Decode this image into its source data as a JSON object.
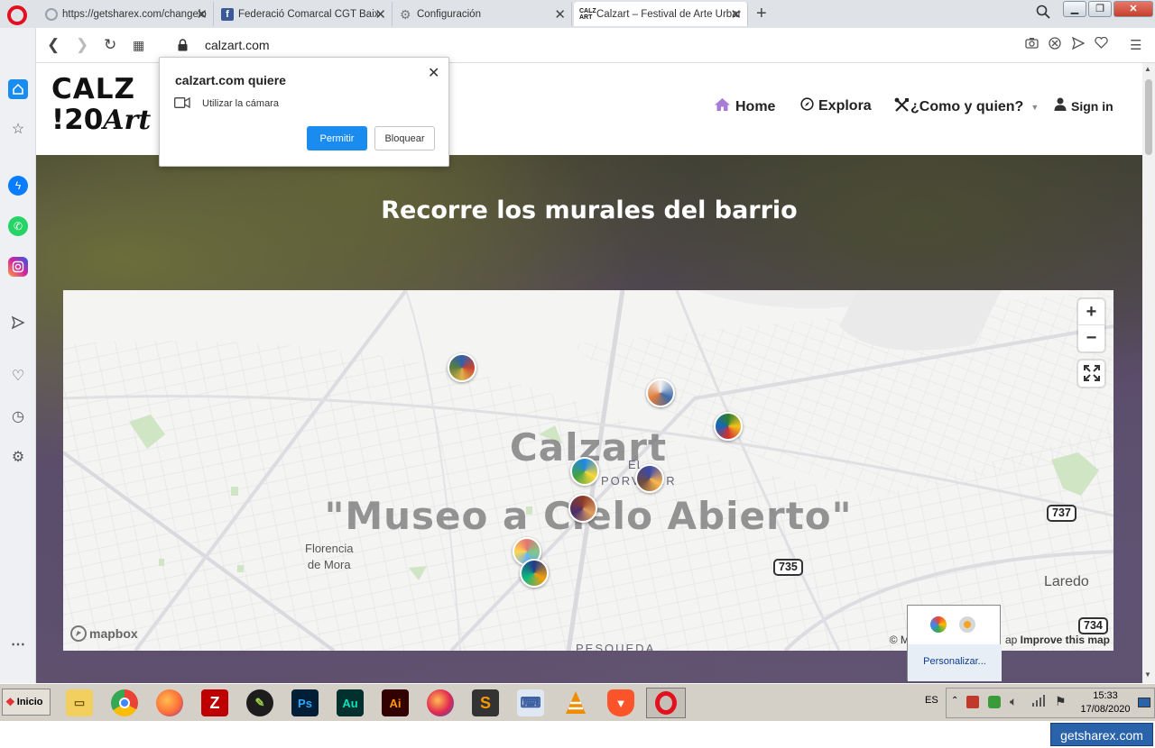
{
  "browser": {
    "tabs": [
      {
        "label": "https://getsharex.com/changelog",
        "favicon_color": "#9aa0a6",
        "icon": "loading-icon"
      },
      {
        "label": "Federació Comarcal CGT Baix Llobregat",
        "favicon_color": "#3b5998",
        "icon": "facebook-icon"
      },
      {
        "label": "Configuración",
        "favicon_color": "#777777",
        "icon": "gear-icon"
      },
      {
        "label": "Calzart – Festival de Arte Urbano",
        "favicon_color": "#111111",
        "icon": "calzart-icon"
      }
    ],
    "url": "calzart.com"
  },
  "popup": {
    "title": "calzart.com quiere",
    "permission": "Utilizar la cámara",
    "allow": "Permitir",
    "block": "Bloquear"
  },
  "site": {
    "logo_line1": "CALZ",
    "logo_line2": "!20",
    "logo_script": "Art",
    "nav": {
      "home": "Home",
      "explore": "Explora",
      "about": "¿Como y quien?",
      "signin": "Sign in"
    },
    "hero_title": "Recorre los murales del barrio"
  },
  "map": {
    "title_line1": "Calzart",
    "title_line2": "\"Museo a Cielo Abierto\"",
    "places": {
      "florencia": "Florencia\nde Mora",
      "porvenir1": "EL",
      "porvenir2": "PORVENIR",
      "laredo": "Laredo",
      "pesqueda": "PESQUEDA"
    },
    "shields": {
      "r737": "737",
      "r735": "735",
      "r734": "734"
    },
    "zoom_in": "+",
    "zoom_out": "−",
    "mapbox": "mapbox",
    "attribution_prefix": "© Map",
    "attribution_mid": "ap",
    "improve": "Improve this map"
  },
  "tray_popup": {
    "link": "Personalizar..."
  },
  "taskbar": {
    "start": "Inicio",
    "lang": "ES",
    "time": "15:33",
    "date": "17/08/2020"
  },
  "watermark": "getsharex.com"
}
